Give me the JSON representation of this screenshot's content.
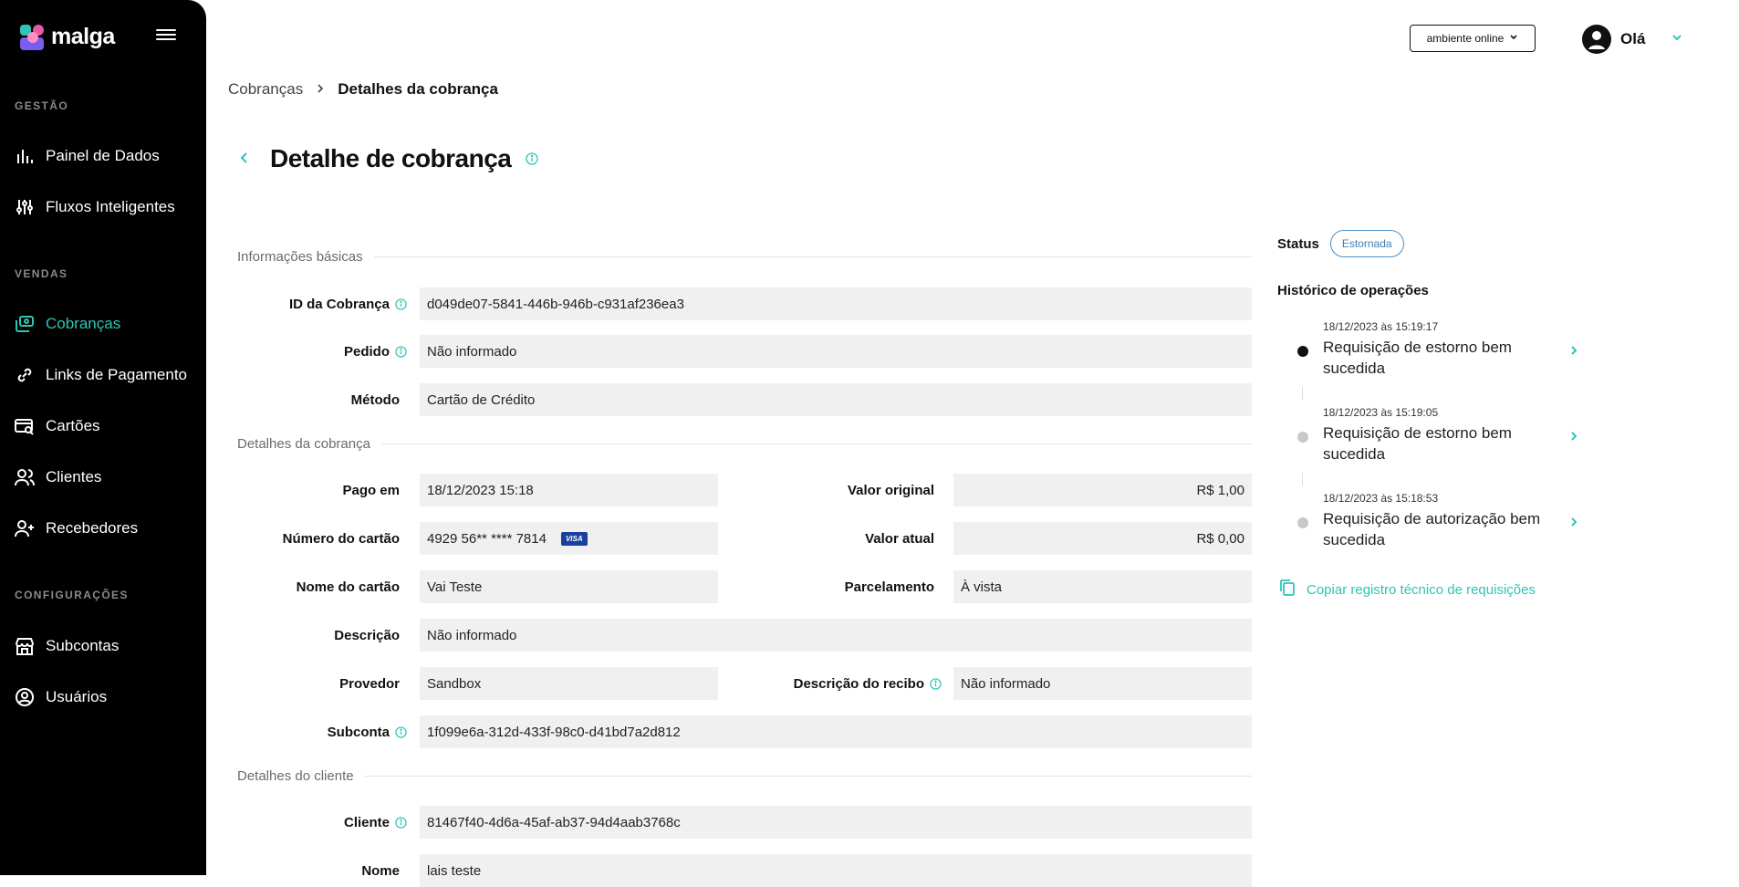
{
  "app": {
    "logo_text": "malga"
  },
  "sidebar": {
    "sections": [
      {
        "label": "GESTÃO"
      },
      {
        "label": "VENDAS"
      },
      {
        "label": "CONFIGURAÇÕES"
      }
    ],
    "items": [
      {
        "label": "Painel de Dados",
        "icon": "bar-chart-icon"
      },
      {
        "label": "Fluxos Inteligentes",
        "icon": "sliders-icon"
      },
      {
        "label": "Cobranças",
        "icon": "charges-icon",
        "active": true
      },
      {
        "label": "Links de Pagamento",
        "icon": "link-icon"
      },
      {
        "label": "Cartões",
        "icon": "card-search-icon"
      },
      {
        "label": "Clientes",
        "icon": "users-icon"
      },
      {
        "label": "Recebedores",
        "icon": "user-plus-icon"
      },
      {
        "label": "Subcontas",
        "icon": "store-icon"
      },
      {
        "label": "Usuários",
        "icon": "user-circle-icon"
      }
    ]
  },
  "header": {
    "environment": "ambiente online",
    "greeting": "Olá"
  },
  "breadcrumb": {
    "parent": "Cobranças",
    "current": "Detalhes da cobrança"
  },
  "page": {
    "title": "Detalhe de cobrança"
  },
  "sections": {
    "basic": "Informações básicas",
    "charge": "Detalhes da cobrança",
    "customer": "Detalhes do cliente"
  },
  "fields": {
    "charge_id": {
      "label": "ID da Cobrança",
      "value": "d049de07-5841-446b-946b-c931af236ea3"
    },
    "order": {
      "label": "Pedido",
      "value": "Não informado"
    },
    "method": {
      "label": "Método",
      "value": "Cartão de Crédito"
    },
    "paid_at": {
      "label": "Pago em",
      "value": "18/12/2023 15:18"
    },
    "original_value": {
      "label": "Valor original",
      "value": "R$ 1,00"
    },
    "card_number": {
      "label": "Número do cartão",
      "value": "4929 56** **** 7814",
      "brand": "VISA"
    },
    "current_value": {
      "label": "Valor atual",
      "value": "R$ 0,00"
    },
    "card_name": {
      "label": "Nome do cartão",
      "value": "Vai Teste"
    },
    "installments": {
      "label": "Parcelamento",
      "value": "À vista"
    },
    "description": {
      "label": "Descrição",
      "value": "Não informado"
    },
    "provider": {
      "label": "Provedor",
      "value": "Sandbox"
    },
    "receipt_description": {
      "label": "Descrição do recibo",
      "value": "Não informado"
    },
    "subaccount": {
      "label": "Subconta",
      "value": "1f099e6a-312d-433f-98c0-d41bd7a2d812"
    },
    "customer": {
      "label": "Cliente",
      "value": "81467f40-4d6a-45af-ab37-94d4aab3768c"
    },
    "name": {
      "label": "Nome",
      "value": "lais teste"
    }
  },
  "status": {
    "label": "Status",
    "value": "Estornada",
    "color": "#3a7fb9"
  },
  "history": {
    "title": "Histórico de operações",
    "items": [
      {
        "time": "18/12/2023 às 15:19:17",
        "text": "Requisição de estorno bem sucedida",
        "dot_color": "#111111"
      },
      {
        "time": "18/12/2023 às 15:19:05",
        "text": "Requisição de estorno bem sucedida",
        "dot_color": "#c8c8c8"
      },
      {
        "time": "18/12/2023 às 15:18:53",
        "text": "Requisição de autorização bem sucedida",
        "dot_color": "#c8c8c8"
      }
    ],
    "copy_label": "Copiar registro técnico de requisições"
  },
  "colors": {
    "accent": "#2ec4b6",
    "sidebar_bg": "#000000",
    "field_bg": "#f0f0f0"
  }
}
